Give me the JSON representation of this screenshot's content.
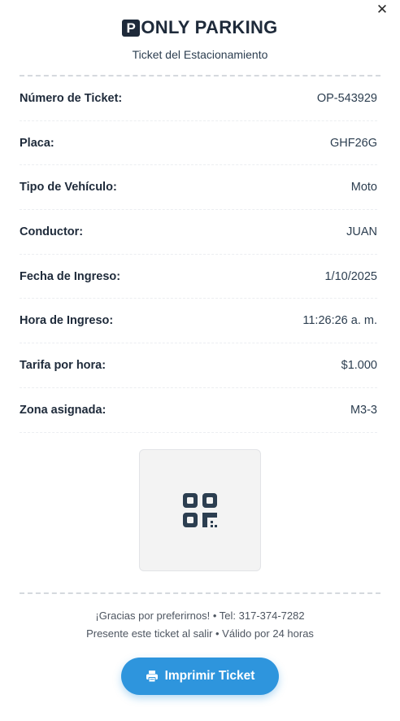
{
  "header": {
    "logo_letter": "P",
    "brand": "ONLY PARKING",
    "subtitle": "Ticket del Estacionamiento"
  },
  "close_icon": "close-icon",
  "details": [
    {
      "label": "Número de Ticket:",
      "value": "OP-543929"
    },
    {
      "label": "Placa:",
      "value": "GHF26G"
    },
    {
      "label": "Tipo de Vehículo:",
      "value": "Moto"
    },
    {
      "label": "Conductor:",
      "value": "JUAN"
    },
    {
      "label": "Fecha de Ingreso:",
      "value": "1/10/2025"
    },
    {
      "label": "Hora de Ingreso:",
      "value": "11:26:26 a. m."
    },
    {
      "label": "Tarifa por hora:",
      "value": "$1.000"
    },
    {
      "label": "Zona asignada:",
      "value": "M3-3"
    }
  ],
  "qr_icon": "qrcode-icon",
  "footer": {
    "line1": "¡Gracias por preferirnos! • Tel: 317-374-7282",
    "line2": "Presente este ticket al salir • Válido por 24 horas"
  },
  "print_button": {
    "label": "Imprimir Ticket",
    "icon": "printer-icon"
  },
  "colors": {
    "brand": "#1e2a3a",
    "accent": "#2e95dd"
  }
}
